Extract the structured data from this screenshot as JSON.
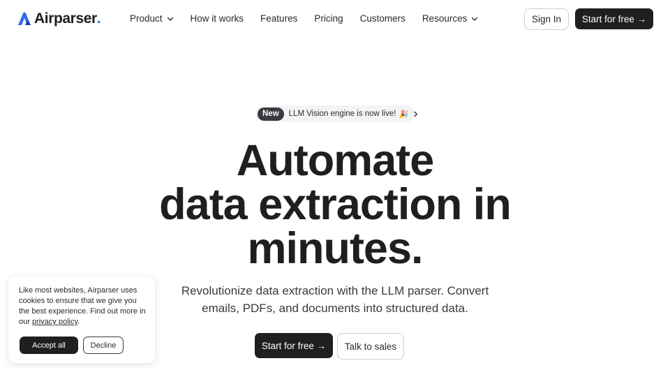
{
  "nav": {
    "brand_name": "Airparser",
    "brand_dot": ".",
    "brand_icon": "airparser-logo-icon",
    "items": [
      {
        "label": "Product",
        "has_dropdown": true
      },
      {
        "label": "How it works",
        "has_dropdown": false
      },
      {
        "label": "Features",
        "has_dropdown": false
      },
      {
        "label": "Pricing",
        "has_dropdown": false
      },
      {
        "label": "Customers",
        "has_dropdown": false
      },
      {
        "label": "Resources",
        "has_dropdown": true
      }
    ],
    "sign_in_label": "Sign In",
    "start_label": "Start for free →"
  },
  "announcement": {
    "badge": "New",
    "text": "LLM Vision engine is now live!",
    "emoji": "🎉",
    "icon": "chevron-right-icon"
  },
  "hero": {
    "headline": [
      "Automate",
      "data extraction in",
      "minutes."
    ],
    "subtitle": [
      "Revolutionize data extraction with the LLM parser. Convert",
      "emails, PDFs, and documents into structured data."
    ],
    "primary_cta": "Start for free →",
    "secondary_cta": "Talk to sales"
  },
  "cookie": {
    "text_before": "Like most websites, Airparser uses cookies to ensure that we give you the best experience. Find out more in our ",
    "link": "privacy policy",
    "text_after": ".",
    "accept_label": "Accept all",
    "decline_label": "Decline"
  },
  "colors": {
    "brand_accent": "#2f6bf2",
    "dark_button": "#1f1f21",
    "text": "#1f1f21"
  }
}
